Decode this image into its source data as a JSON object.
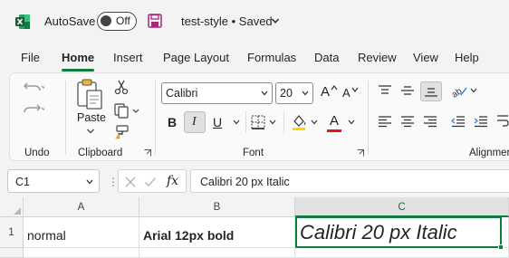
{
  "titlebar": {
    "app_icon": "excel-logo-icon",
    "autosave_label": "AutoSave",
    "autosave_state": "Off",
    "save_icon": "save-icon",
    "document_title": "test-style • Saved"
  },
  "menu": {
    "tabs": [
      {
        "label": "File"
      },
      {
        "label": "Home"
      },
      {
        "label": "Insert"
      },
      {
        "label": "Page Layout"
      },
      {
        "label": "Formulas"
      },
      {
        "label": "Data"
      },
      {
        "label": "Review"
      },
      {
        "label": "View"
      },
      {
        "label": "Help"
      }
    ],
    "active_tab": "Home"
  },
  "ribbon": {
    "groups": {
      "undo": "Undo",
      "clipboard": "Clipboard",
      "font": "Font",
      "alignment": "Alignmer"
    },
    "paste_label": "Paste",
    "font_name": "Calibri",
    "font_size": "20",
    "bold_label": "B",
    "italic_label": "I",
    "underline_label": "U",
    "grow_font_label": "A",
    "shrink_font_label": "A",
    "font_color_label": "A",
    "highlight_color": "#ffd700",
    "font_color": "#e81123"
  },
  "formula_bar": {
    "name_box": "C1",
    "fx_label": "fx",
    "formula": "Calibri 20 px Italic"
  },
  "sheet": {
    "columns": [
      "A",
      "B",
      "C"
    ],
    "selected_column": "C",
    "rows": [
      {
        "number": "1",
        "cells": [
          "normal",
          "Arial 12px  bold",
          "Calibri 20 px Italic"
        ]
      }
    ]
  },
  "colors": {
    "accent": "#107c41",
    "ribbon_bg": "#fafafa",
    "window_bg": "#f3f3f3"
  }
}
